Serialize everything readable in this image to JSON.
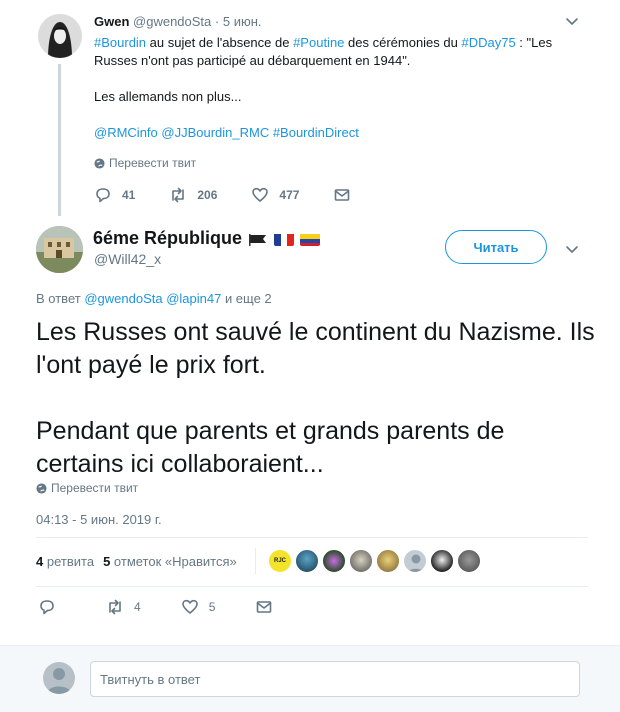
{
  "parent_tweet": {
    "author_name": "Gwen",
    "author_handle": "@gwendoSta",
    "separator": "·",
    "date": "5 июн.",
    "text_segments": [
      {
        "text": "#Bourdin",
        "link": true
      },
      {
        "text": " au sujet de l'absence de ",
        "link": false
      },
      {
        "text": "#Poutine",
        "link": true
      },
      {
        "text": " des cérémonies du ",
        "link": false
      },
      {
        "text": "#DDay75",
        "link": true
      },
      {
        "text": " : \"Les Russes n'ont pas participé au débarquement en 1944\".",
        "link": false
      }
    ],
    "line2": "Les allemands non plus...",
    "mentions": "@RMCinfo @JJBourdin_RMC #BourdinDirect",
    "translate": "Перевести твит",
    "replies": "41",
    "retweets": "206",
    "likes": "477"
  },
  "reply_tweet": {
    "author_name": "6éme République",
    "author_handle": "@Will42_x",
    "follow_label": "Читать",
    "in_reply_prefix": "В ответ",
    "in_reply_mentions": "@gwendoSta @lapin47",
    "in_reply_suffix": "и еще 2",
    "text_p1": "Les Russes ont sauvé le continent du Nazisme. Ils l'ont payé le prix fort.",
    "text_p2": "Pendant que parents et grands parents de certains ici collaboraient...",
    "translate": "Перевести твит",
    "timestamp": "04:13 - 5 июн. 2019 г.",
    "retweets_count": "4",
    "retweets_label": "ретвита",
    "likes_count": "5",
    "likes_label": "отметок «Нравится»",
    "replies": "",
    "retweets": "4",
    "likes": "5",
    "liker_badge": "RJC"
  },
  "composer": {
    "placeholder": "Твитнуть в ответ"
  },
  "colors": {
    "link": "#1b95e0",
    "muted": "#657786",
    "text": "#14171a"
  },
  "icons": [
    "reply-icon",
    "retweet-icon",
    "like-icon",
    "message-icon",
    "chevron-down-icon",
    "globe-icon"
  ]
}
